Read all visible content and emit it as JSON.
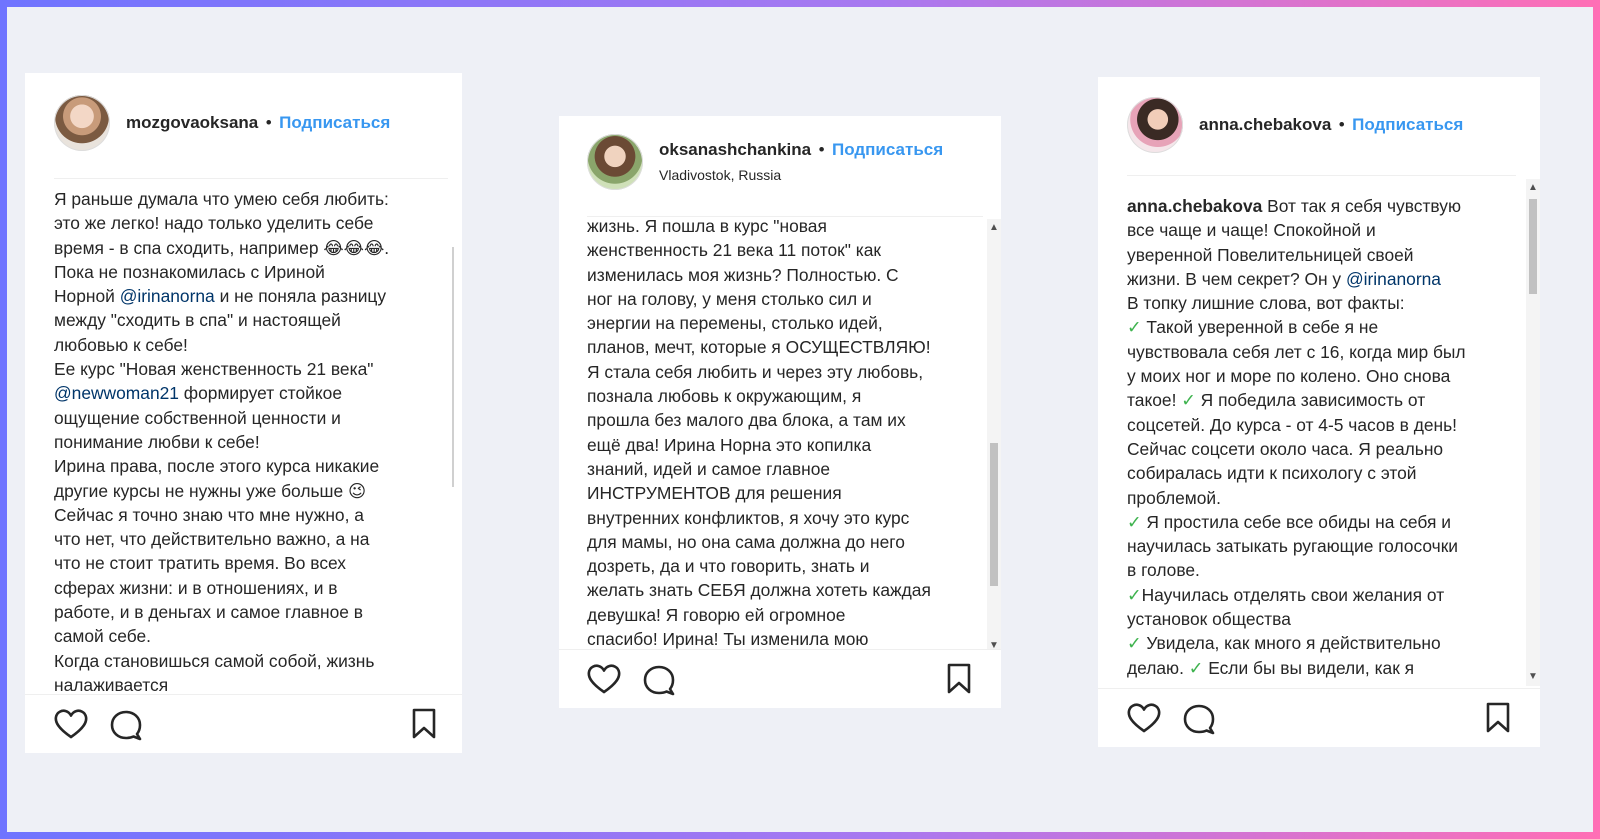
{
  "posts": [
    {
      "username": "mozgovaoksana",
      "separator": "•",
      "follow_label": "Подписаться",
      "avatar_icon": "avatar-mozgovaoksana",
      "lines": [
        "Я раньше думала что умею себя любить:",
        "это же легко! надо только уделить себе",
        "время - в спа сходить, например 😂😂😂.",
        "Пока не познакомилась с Ириной",
        "Норной @irinanorna и не поняла разницу",
        "между \"сходить в спа\" и настоящей",
        "любовью к себе!",
        "Ее курс \"Новая женственность 21 века\"",
        "@newwoman21 формирует стойкое",
        "ощущение собственной ценности и",
        "понимание любви к себе!",
        "Ирина права, после этого курса никакие",
        "другие курсы не нужны уже больше 😉",
        "Сейчас я точно знаю что мне нужно, а",
        "что нет, что действительно важно, а на",
        "что не стоит тратить время. Во всех",
        "сферах жизни: и в отношениях, и в",
        "работе, и в деньгах и самое главное в",
        "самой себе.",
        "Когда становишься самой собой, жизнь",
        "налаживается"
      ]
    },
    {
      "username": "oksanashchankina",
      "separator": "•",
      "follow_label": "Подписаться",
      "location": "Vladivostok, Russia",
      "avatar_icon": "avatar-oksanashchankina",
      "lines": [
        "жизнь. Я пошла в курс \"новая",
        "женственность 21 века 11 поток\" как",
        "изменилась моя жизнь? Полностью. С",
        "ног на голову, у меня столько сил и",
        "энергии на перемены, столько идей,",
        "планов, мечт, которые я ОСУЩЕСТВЛЯЮ!",
        "Я стала себя любить и через эту любовь,",
        "познала любовь к окружающим, я",
        "прошла без малого два блока, а там их",
        "ещё два! Ирина Норна это копилка",
        "знаний, идей и самое главное",
        "ИНСТРУМЕНТОВ для решения",
        "внутренних конфликтов, я хочу это курс",
        "для мамы, но она сама должна до него",
        "дозреть, да и что говорить, знать и",
        "желать знать СЕБЯ должна хотеть каждая",
        "девушка! Я говорю ей огромное",
        "спасибо! Ирина! Ты изменила мою"
      ]
    },
    {
      "username": "anna.chebakova",
      "separator": "•",
      "follow_label": "Подписаться",
      "avatar_icon": "avatar-anna-chebakova",
      "lines": [
        "anna.chebakova Вот так я себя чувствую",
        "все чаще и чаще! Спокойной и",
        "уверенной Повелительницей своей",
        "жизни. В чем секрет? Он у @irinanorna",
        "В топку лишние слова, вот факты:",
        "✓ Такой уверенной в себе я не",
        "чувствовала себя лет с 16, когда мир был",
        "у моих ног и море по колено. Оно снова",
        "такое! ✓ Я победила зависимость от",
        "соцсетей. До курса - от 4-5 часов в день!",
        "Сейчас соцсети около часа. Я реально",
        "собиралась идти к психологу с этой",
        "проблемой.",
        "✓ Я простила себе все обиды на себя и",
        "научилась затыкать ругающие голосочки",
        "в голове.",
        "✓Научилась отделять свои желания от",
        "установок общества",
        "✓ Увидела, как много я действительно",
        "делаю. ✓ Если бы вы видели, как я"
      ]
    }
  ],
  "icons": [
    "heart-icon",
    "comment-icon",
    "bookmark-icon"
  ],
  "colors": {
    "link": "#3897f0",
    "mention": "#003569",
    "check": "#3fb34f",
    "frame_start": "#6f74ff",
    "frame_end": "#ff6fb5"
  }
}
